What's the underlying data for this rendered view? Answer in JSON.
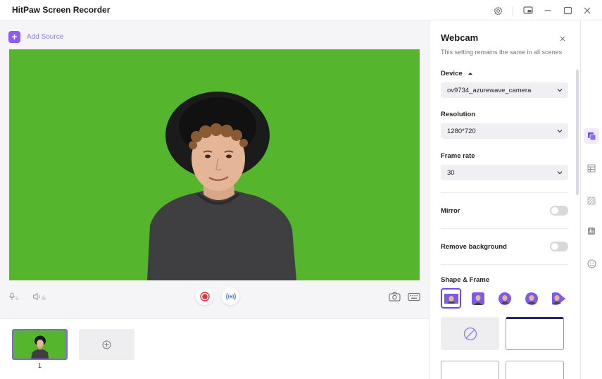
{
  "app": {
    "title": "HitPaw Screen Recorder"
  },
  "source": {
    "add_label": "Add Source"
  },
  "scenes": [
    {
      "number": "1"
    }
  ],
  "panel": {
    "title": "Webcam",
    "subtitle": "This setting remains the same in all scenes",
    "device": {
      "label": "Device",
      "value": "ov9734_azurewave_camera"
    },
    "resolution": {
      "label": "Resolution",
      "value": "1280*720"
    },
    "frame_rate": {
      "label": "Frame rate",
      "value": "30"
    },
    "mirror": {
      "label": "Mirror",
      "on": false
    },
    "remove_background": {
      "label": "Remove background",
      "on": false
    },
    "shape_frame": {
      "label": "Shape & Frame"
    }
  },
  "colors": {
    "accent": "#8b5cf6",
    "preview_bg": "#55b52d",
    "record": "#e5333a"
  },
  "icons": [
    "settings-icon",
    "picture-in-picture-icon",
    "minimize-icon",
    "maximize-icon",
    "close-icon",
    "microphone-icon",
    "speaker-icon",
    "record-icon",
    "broadcast-icon",
    "camera-icon",
    "keyboard-icon",
    "add-icon",
    "no-frame-icon",
    "layers-icon",
    "layout-icon",
    "texture-icon",
    "text-icon",
    "sticker-icon"
  ]
}
